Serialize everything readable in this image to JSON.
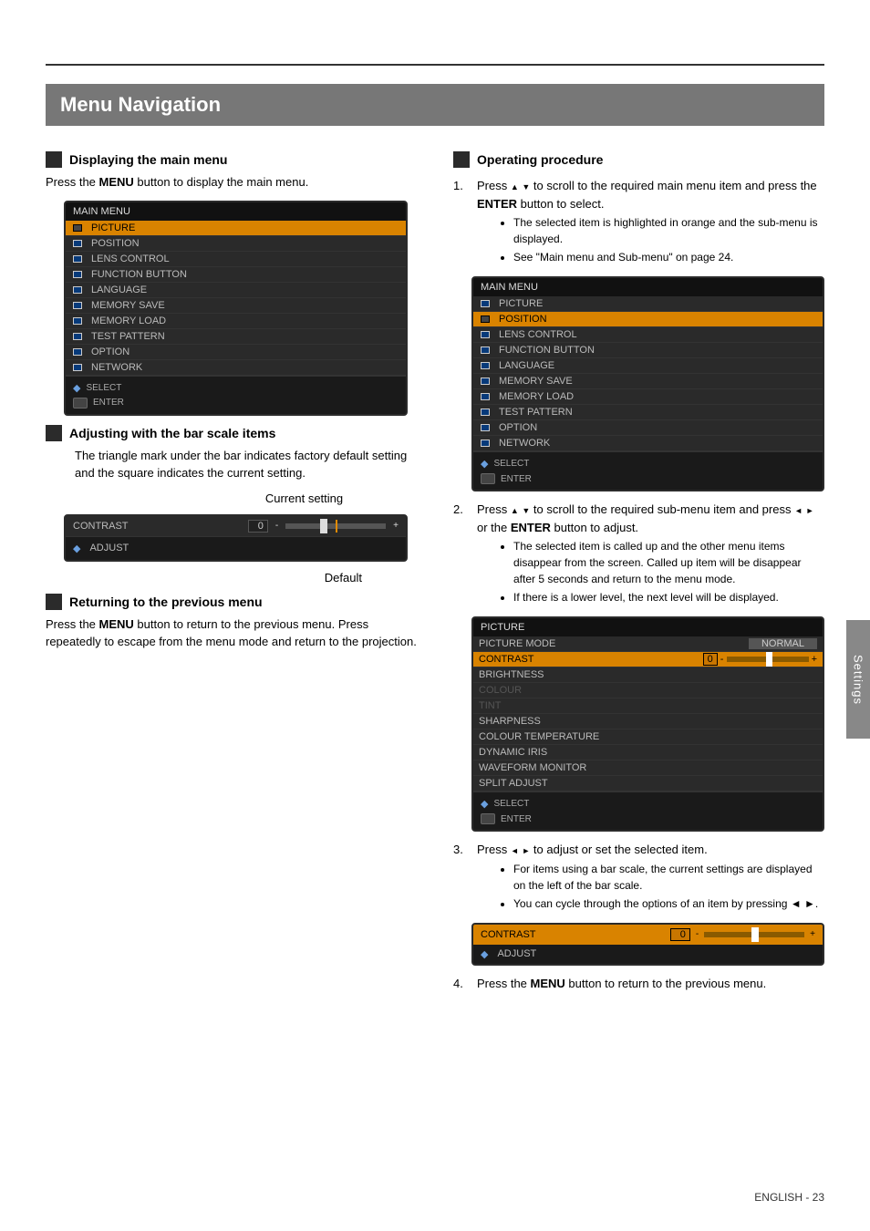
{
  "page": {
    "title": "Menu Navigation",
    "side_tab": "Settings",
    "footnote": "ENGLISH - 23"
  },
  "col_left": {
    "s1_title": "Displaying the main menu",
    "s1_text_a": "Press the ",
    "s1_text_b": "MENU",
    "s1_text_c": " button to display the main menu.",
    "s2_title": "Adjusting with the bar scale items",
    "s2_text": "The triangle mark under the bar indicates factory default setting and the square indicates the current setting.",
    "s2_current": "Current setting",
    "s2_default": "Default",
    "s3_title": "Returning to the previous menu",
    "s3_text_a": "Press the ",
    "s3_text_b": "MENU",
    "s3_text_c": " button to return to the previous menu. Press repeatedly to escape from the menu mode and return to the projection.",
    "bar_item": "CONTRAST",
    "bar_val": "0",
    "adjust_hint": "ADJUST"
  },
  "col_right": {
    "s1_title": "Operating procedure",
    "step1_a": "Press ",
    "step1_b": " to scroll to the required main menu item and press the ",
    "step1_c": "ENTER",
    "step1_d": " button to select.",
    "step1_bullets": [
      "The selected item is highlighted in orange and the sub-menu is displayed.",
      "See \"Main menu and Sub-menu\" on page 24."
    ],
    "step2_a": "Press ",
    "step2_b": " to scroll to the required sub-menu item and press ",
    "step2_c": " or the ",
    "step2_d": "ENTER",
    "step2_e": " button to adjust.",
    "step2_bullets": [
      "The selected item is called up and the other menu items disappear from the screen. Called up item will be disappear after 5 seconds and return to the menu mode.",
      "If there is a lower level, the next level will be displayed."
    ],
    "step3_a": "Press ",
    "step3_b": " to adjust or set the selected item.",
    "step3_bullets": [
      "For items using a bar scale, the current settings are displayed on the left of the bar scale.",
      "You can cycle through the options of an item by pressing ◄ ►."
    ],
    "step4_a": "Press the ",
    "step4_b": "MENU",
    "step4_c": " button to return to the previous menu.",
    "sub_title": "PICTURE",
    "sub_items": [
      "PICTURE MODE",
      "CONTRAST",
      "BRIGHTNESS",
      "COLOUR",
      "TINT",
      "SHARPNESS",
      "COLOUR TEMPERATURE",
      "DYNAMIC IRIS",
      "WAVEFORM MONITOR",
      "SPLIT ADJUST"
    ],
    "sub_mode_val": "NORMAL",
    "enter_hint": "ENTER",
    "select_hint": "SELECT",
    "adjust_hint": "ADJUST",
    "bar_item": "CONTRAST",
    "bar_val": "0"
  },
  "menu_items": [
    "PICTURE",
    "POSITION",
    "LENS CONTROL",
    "FUNCTION BUTTON",
    "LANGUAGE",
    "MEMORY SAVE",
    "MEMORY LOAD",
    "TEST PATTERN",
    "OPTION",
    "NETWORK"
  ],
  "menu_header": "MAIN MENU",
  "menu_select": "SELECT",
  "menu_enter": "ENTER"
}
